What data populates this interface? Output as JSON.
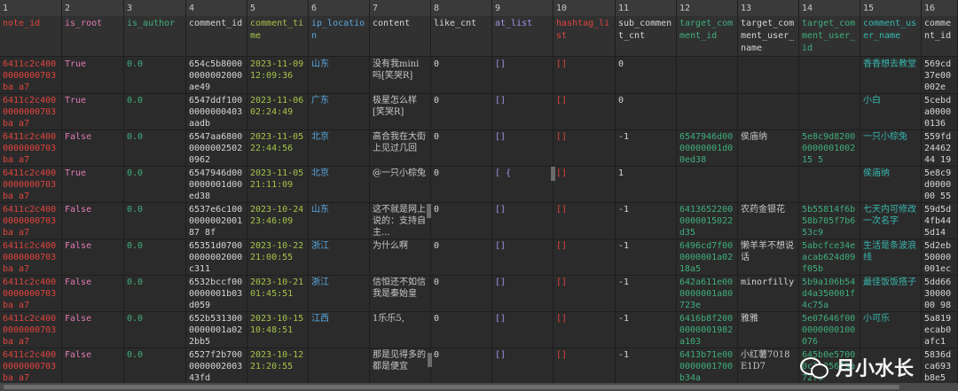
{
  "colors": {
    "red": "#e0443e",
    "white": "#d6d6d6",
    "green": "#3fae7c",
    "cyan": "#38b8b0",
    "yellow_green": "#a6c34a",
    "purple": "#a58fe6",
    "blue": "#5aa8e0",
    "pink": "#e07ab6",
    "cjk": "#c8c8c8"
  },
  "columns": [
    {
      "num": "1",
      "name": "note_id",
      "color": "red",
      "w": 70
    },
    {
      "num": "2",
      "name": "is_root",
      "color": "pink",
      "w": 70
    },
    {
      "num": "3",
      "name": "is_author",
      "color": "green",
      "w": 70
    },
    {
      "num": "4",
      "name": "comment_id",
      "color": "white",
      "w": 69
    },
    {
      "num": "5",
      "name": "comment_time",
      "color": "yellow_green",
      "w": 69
    },
    {
      "num": "6",
      "name": "ip_location",
      "color": "blue",
      "w": 69
    },
    {
      "num": "7",
      "name": "content",
      "color": "white",
      "w": 69
    },
    {
      "num": "8",
      "name": "like_cnt",
      "color": "white",
      "w": 69
    },
    {
      "num": "9",
      "name": "at_list",
      "color": "purple",
      "w": 69
    },
    {
      "num": "10",
      "name": "hashtag_list",
      "color": "red",
      "w": 70
    },
    {
      "num": "11",
      "name": "sub_comment_cnt",
      "color": "white",
      "w": 69
    },
    {
      "num": "12",
      "name": "target_comment_id",
      "color": "green",
      "w": 69
    },
    {
      "num": "13",
      "name": "target_comment_user_name",
      "color": "white",
      "w": 69
    },
    {
      "num": "14",
      "name": "target_comment_user_id",
      "color": "green",
      "w": 69
    },
    {
      "num": "15",
      "name": "comment_user_name",
      "color": "cyan",
      "w": 69
    },
    {
      "num": "16",
      "name": "comment_id",
      "color": "white",
      "w": 41
    }
  ],
  "rows": [
    [
      "6411c2c4000000000703ba a7",
      "True",
      "0.0",
      "654c5b80000000002000ae49",
      "2023-11-09 12:09:36",
      "山东",
      "没有我mini吗[笑哭R]",
      "0",
      "[]",
      "[]",
      "0",
      "",
      "",
      "",
      "香香想去教堂",
      "569cd37e00002e"
    ],
    [
      "6411c2c4000000000703ba a7",
      "True",
      "0.0",
      "6547ddf1000000000403aadb",
      "2023-11-06 02:24:49",
      "广东",
      "极星怎么样[笑哭R]",
      "0",
      "[]",
      "[]",
      "0",
      "",
      "",
      "",
      "小白",
      "5cebda00000136"
    ],
    [
      "6411c2c4000000000703ba a7",
      "False",
      "0.0",
      "6547aa680000000025020962",
      "2023-11-05 22:44:56",
      "北京",
      "高合我在大街上见过几回",
      "0",
      "[]",
      "[]",
      "-1",
      "6547946d0000000001d00ed38",
      "侯庙纳",
      "5e8c9d8200000000100215 5",
      "一只小棕兔",
      "559fd2446244 19"
    ],
    [
      "6411c2c4000000000703ba a7",
      "True",
      "0.0",
      "6547946d000000001d00ed38",
      "2023-11-05 21:11:09",
      "北京",
      "@一只小棕兔",
      "0",
      "[ {",
      "[]",
      "1",
      "",
      "",
      "",
      "侯庙纳",
      "5e8c9d000000 55"
    ],
    [
      "6411c2c4000000000703ba a7",
      "False",
      "0.0",
      "6537e6c100000000200187 8f",
      "2023-10-24 23:46:09",
      "山东",
      "这不就是网上说的：支持自主...",
      "0",
      "[]",
      "[]",
      "-1",
      "64136522000000015022d35",
      "农药金银花",
      "5b55814f6b58b705f7b653c9",
      "七天内可修改一次名字",
      "59d5d4fb445d14"
    ],
    [
      "6411c2c4000000000703ba a7",
      "False",
      "0.0",
      "65351d07000000002000c311",
      "2023-10-22 21:00:55",
      "浙江",
      "为什么啊",
      "0",
      "[]",
      "[]",
      "-1",
      "6496cd7f000000001a0218a5",
      "懒羊羊不想说话",
      "5abcfce34eacab624d09f05b",
      "生活是条波浪线",
      "5d2eb50000001ec"
    ],
    [
      "6411c2c4000000000703ba a7",
      "False",
      "0.0",
      "6532bccf000000001b03d059",
      "2023-10-21 01:45:51",
      "浙江",
      "信恒还不如信我是秦始皇",
      "0",
      "[]",
      "[]",
      "-1",
      "642a611e000000001a80723e",
      "minorfilly",
      "5b9a106b54d4a350001f4c75a",
      "最佳饭饭搭子",
      "5dd663000000 98"
    ],
    [
      "6411c2c4000000000703ba a7",
      "False",
      "0.0",
      "652b5313000000001a022bb5",
      "2023-10-15 10:48:51",
      "江西",
      "1乐乐5,",
      "0",
      "[]",
      "[]",
      "-1",
      "6416b8f2000000001982a103",
      "雅雅",
      "5e07646f000000000100076",
      "小可乐",
      "5a819ecab0afc1"
    ],
    [
      "6411c2c4000000000703ba a7",
      "False",
      "0.0",
      "6527f2b700000000200343fd",
      "2023-10-12 21:20:55",
      "",
      "那是见得多的都是便宜",
      "0",
      "[]",
      "[]",
      "-1",
      "6413b71e000000001700b34a",
      "小红薯7018E1D7",
      "645b0e57000c2b256f9a72f6",
      "",
      "5836dca693b8e5"
    ]
  ],
  "watermark": {
    "icon": "wechat-icon",
    "text": "月小水长"
  }
}
